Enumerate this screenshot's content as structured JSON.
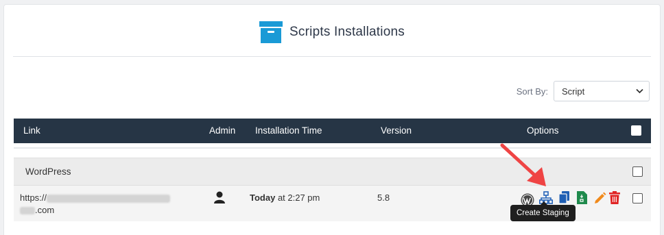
{
  "page": {
    "title": "Scripts Installations",
    "title_icon": "archive-box-icon"
  },
  "sort": {
    "label": "Sort By:",
    "selected": "Script"
  },
  "table": {
    "columns": [
      "Link",
      "Admin",
      "Installation Time",
      "Version",
      "Options"
    ],
    "groups": [
      {
        "name": "WordPress",
        "rows": [
          {
            "link_prefix": "https://",
            "link_suffix": ".com",
            "admin_icon": "user-icon",
            "time_bold": "Today",
            "time_rest": " at 2:27 pm",
            "version": "5.8",
            "options": [
              "wordpress-admin-icon",
              "create-staging-icon",
              "clone-icon",
              "backup-icon",
              "edit-icon",
              "remove-icon"
            ]
          }
        ]
      }
    ]
  },
  "tooltip": {
    "text": "Create Staging"
  },
  "colors": {
    "accent": "#1a9ad6",
    "header_bg": "#263545",
    "arrow": "#ef4444"
  }
}
